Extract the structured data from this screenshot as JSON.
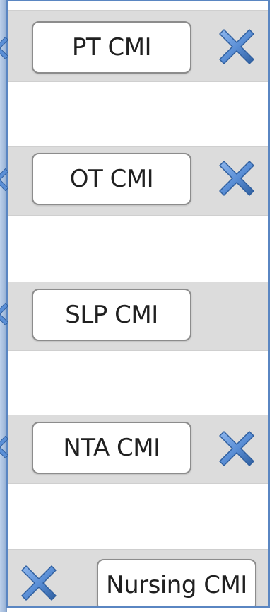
{
  "rows": [
    {
      "label": "PT CMI",
      "has_remove": true
    },
    {
      "label": "OT CMI",
      "has_remove": true
    },
    {
      "label": "SLP CMI",
      "has_remove": false
    },
    {
      "label": "NTA CMI",
      "has_remove": true
    },
    {
      "label": "Nursing CMI",
      "has_remove": true
    }
  ],
  "colors": {
    "band": "#dcdcdc",
    "frame": "#5a86c2",
    "icon_blue": "#5b8fd6",
    "icon_dark": "#2f5f9f"
  },
  "icons": {
    "remove": "blue-x-icon"
  }
}
